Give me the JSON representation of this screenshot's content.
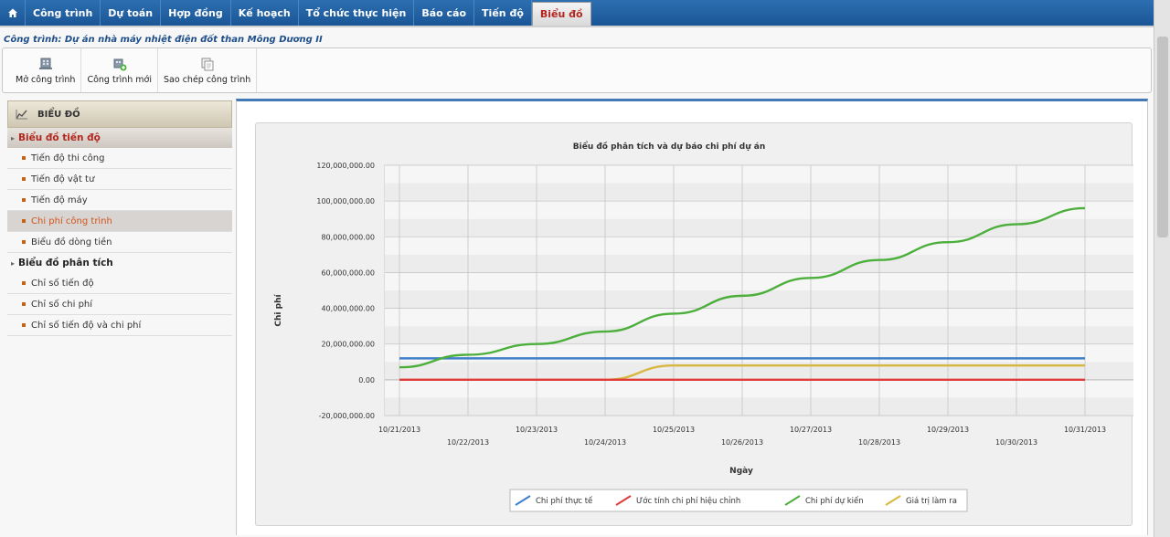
{
  "menu": {
    "home_icon": "home-icon",
    "items": [
      "Công trình",
      "Dự toán",
      "Hợp đồng",
      "Kế hoạch",
      "Tổ chức thực hiện",
      "Báo cáo",
      "Tiến độ",
      "Biểu đồ"
    ],
    "active_index": 7
  },
  "project": {
    "line": "Công trình: Dự án nhà máy nhiệt điện đốt than Mông Dương II"
  },
  "toolbar": {
    "buttons": [
      {
        "label": "Mở công trình",
        "icon": "open-project-icon"
      },
      {
        "label": "Công trình mới",
        "icon": "new-project-icon"
      },
      {
        "label": "Sao chép công trình",
        "icon": "copy-project-icon"
      }
    ]
  },
  "sidebar": {
    "header": "BIỂU ĐỒ",
    "header_icon": "chart-icon",
    "groups": [
      {
        "label": "Biểu đồ tiến độ",
        "active": true,
        "items": [
          "Tiến độ thi công",
          "Tiến độ vật tư",
          "Tiến độ máy",
          "Chi phí công trình",
          "Biểu đồ dòng tiền"
        ],
        "active_item": 3
      },
      {
        "label": "Biểu đồ phân tích",
        "active": false,
        "items": [
          "Chỉ số tiến độ",
          "Chỉ số chi phí",
          "Chỉ số tiến độ và chi phí"
        ]
      }
    ]
  },
  "chart_data": {
    "type": "line",
    "title": "Biểu đồ phân tích và dự báo chi phí dự án",
    "xlabel": "Ngày",
    "ylabel": "Chi phí",
    "x": [
      "10/21/2013",
      "10/22/2013",
      "10/23/2013",
      "10/24/2013",
      "10/25/2013",
      "10/26/2013",
      "10/27/2013",
      "10/28/2013",
      "10/29/2013",
      "10/30/2013",
      "10/31/2013"
    ],
    "ylim": [
      -20000000,
      120000000
    ],
    "yticks": [
      -20000000,
      0,
      20000000,
      40000000,
      60000000,
      80000000,
      100000000,
      120000000
    ],
    "ytick_labels": [
      "-20,000,000.00",
      "0.00",
      "20,000,000.00",
      "40,000,000.00",
      "60,000,000.00",
      "80,000,000.00",
      "100,000,000.00",
      "120,000,000.00"
    ],
    "grid": true,
    "legend_position": "bottom",
    "series": [
      {
        "name": "Chi phí thực tế",
        "color": "#3f7fc9",
        "values": [
          12000000,
          12000000,
          12000000,
          12000000,
          12000000,
          12000000,
          12000000,
          12000000,
          12000000,
          12000000,
          12000000
        ]
      },
      {
        "name": "Ước tính chi phí hiệu chỉnh",
        "color": "#e03a3a",
        "values": [
          0,
          0,
          0,
          0,
          0,
          0,
          0,
          0,
          0,
          0,
          0
        ]
      },
      {
        "name": "Chi phí dự kiến",
        "color": "#4caf3c",
        "values": [
          7000000,
          14000000,
          20000000,
          27000000,
          37000000,
          47000000,
          57000000,
          67000000,
          77000000,
          87000000,
          96000000
        ]
      },
      {
        "name": "Giá trị làm ra",
        "color": "#d8b640",
        "values": [
          0,
          0,
          0,
          0,
          8000000,
          8000000,
          8000000,
          8000000,
          8000000,
          8000000,
          8000000
        ]
      }
    ]
  }
}
